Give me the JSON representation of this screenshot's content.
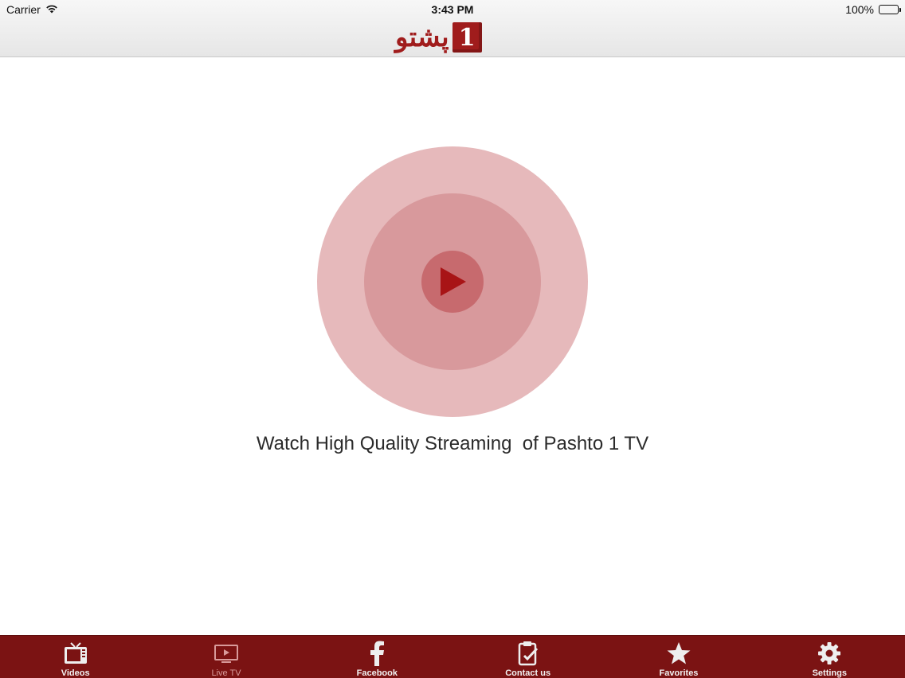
{
  "status_bar": {
    "carrier": "Carrier",
    "time": "3:43 PM",
    "battery": "100%"
  },
  "header": {
    "logo_text": "پشتو",
    "logo_mark": "1"
  },
  "main": {
    "caption": "Watch High Quality Streaming  of Pashto 1 TV"
  },
  "tab_bar": {
    "tabs": [
      {
        "label": "Videos",
        "icon": "tv-icon",
        "active": false
      },
      {
        "label": "Live TV",
        "icon": "live-tv-icon",
        "active": true
      },
      {
        "label": "Facebook",
        "icon": "facebook-icon",
        "active": false
      },
      {
        "label": "Contact us",
        "icon": "clipboard-check-icon",
        "active": false
      },
      {
        "label": "Favorites",
        "icon": "star-icon",
        "active": false
      },
      {
        "label": "Settings",
        "icon": "gear-icon",
        "active": false
      }
    ]
  },
  "colors": {
    "brand_red": "#7b1313",
    "logo_red": "#a01c1c",
    "play_outer": "#e6b9bb",
    "play_middle": "#d8999c",
    "play_inner": "#c76a6e",
    "play_triangle": "#a81416",
    "active_tab_label": "#d89a9a"
  }
}
